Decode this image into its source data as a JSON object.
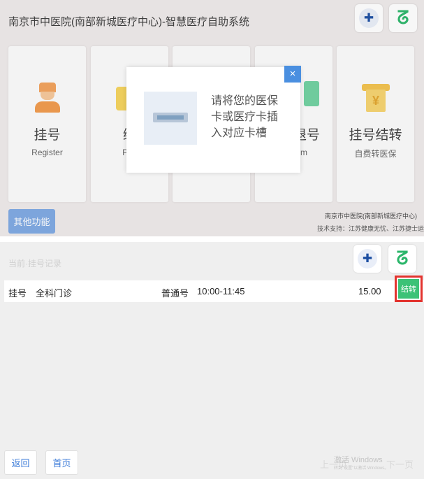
{
  "top": {
    "title": "南京市中医院(南部新城医疗中心)-智慧医疗自助系统",
    "tiles": [
      {
        "label": "挂号",
        "sub": "Register"
      },
      {
        "label": "缴",
        "sub": "Pay"
      },
      {
        "label": "",
        "sub": ""
      },
      {
        "label": "退号",
        "sub": "m"
      },
      {
        "label": "挂号结转",
        "sub": "自费转医保"
      }
    ],
    "other_button": "其他功能",
    "footer_line1": "南京市中医院(南部新城医疗中心)",
    "footer_line2": "技术支持：江苏健康无忧、江苏捷士运"
  },
  "dialog": {
    "close_symbol": "×",
    "message": "请将您的医保卡或医疗卡插入对应卡槽"
  },
  "bottom": {
    "faded_title": "当前·挂号记录",
    "row": {
      "type": "挂号",
      "department": "全科门诊",
      "level": "普通号",
      "time": "10:00-11:45",
      "fee": "15.00",
      "action": "结转"
    },
    "back_button": "返回",
    "home_button": "首页",
    "prev_page": "上一页",
    "next_page": "下一页",
    "watermark_line1": "激活 Windows",
    "watermark_line2": "转到\"设置\"以激活 Windows。"
  },
  "icons": {
    "hospital_logo": "hospital-emblem-icon",
    "ok_logo": "ok-hand-icon",
    "register": "nurse-icon",
    "pay": "folder-icon",
    "insurance": "insurance-doc-icon",
    "card": "card-slot-icon"
  },
  "colors": {
    "accent_blue": "#4a8fe0",
    "settle_green": "#3cc277",
    "highlight_red": "#e3342f"
  }
}
